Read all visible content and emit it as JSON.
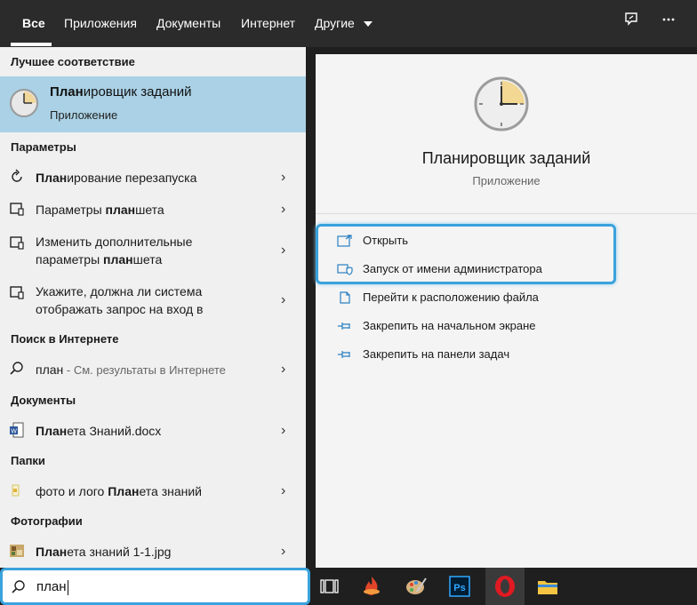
{
  "tabs": [
    {
      "label": "Все"
    },
    {
      "label": "Приложения"
    },
    {
      "label": "Документы"
    },
    {
      "label": "Интернет"
    },
    {
      "label": "Другие"
    }
  ],
  "topbar": {
    "feedback_icon": "feedback-icon",
    "more_icon": "more-icon"
  },
  "left": {
    "best_match_header": "Лучшее соответствие",
    "best_match": {
      "title_bold": "План",
      "title_rest": "ировщик заданий",
      "subtitle": "Приложение",
      "icon": "clock-icon"
    },
    "settings_header": "Параметры",
    "settings": [
      {
        "bold": "План",
        "rest": "ирование перезапуска",
        "icon": "restart-icon"
      },
      {
        "pre": "Параметры ",
        "bold": "план",
        "rest": "шета",
        "icon": "tablet-icon"
      },
      {
        "line1": "Изменить дополнительные",
        "line2_pre": "параметры ",
        "line2_bold": "план",
        "line2_rest": "шета",
        "icon": "tablet-icon"
      },
      {
        "line1": "Укажите, должна ли система",
        "line2": "отображать запрос на вход в",
        "icon": "tablet-icon"
      }
    ],
    "web_header": "Поиск в Интернете",
    "web": {
      "query": "план",
      "hint": " - См. результаты в Интернете",
      "icon": "search-icon"
    },
    "docs_header": "Документы",
    "doc": {
      "bold": "План",
      "rest": "ета Знаний.docx",
      "icon": "word-doc-icon"
    },
    "folders_header": "Папки",
    "folder": {
      "pre": "фото и лого ",
      "bold": "План",
      "rest": "ета знаний",
      "icon": "folder-icon"
    },
    "photos_header": "Фотографии",
    "photo": {
      "bold": "План",
      "rest": "ета знаний 1-1.jpg",
      "icon": "image-icon"
    }
  },
  "preview": {
    "title": "Планировщик заданий",
    "subtitle": "Приложение",
    "actions": [
      {
        "label": "Открыть",
        "icon": "open-icon"
      },
      {
        "label": "Запуск от имени администратора",
        "icon": "shield-icon"
      },
      {
        "label": "Перейти к расположению файла",
        "icon": "file-location-icon"
      },
      {
        "label": "Закрепить на начальном экране",
        "icon": "pin-icon"
      },
      {
        "label": "Закрепить на панели задач",
        "icon": "pin-icon"
      }
    ]
  },
  "search": {
    "value": "план"
  },
  "taskbar": {
    "items": [
      "task-view-icon",
      "app-fire-icon",
      "paint-icon",
      "photoshop-icon",
      "opera-icon",
      "file-explorer-icon"
    ],
    "photoshop_label": "Ps"
  },
  "colors": {
    "accent": "#3aa2dc",
    "selected": "#aad1e5",
    "topbar": "#2b2b2b"
  }
}
